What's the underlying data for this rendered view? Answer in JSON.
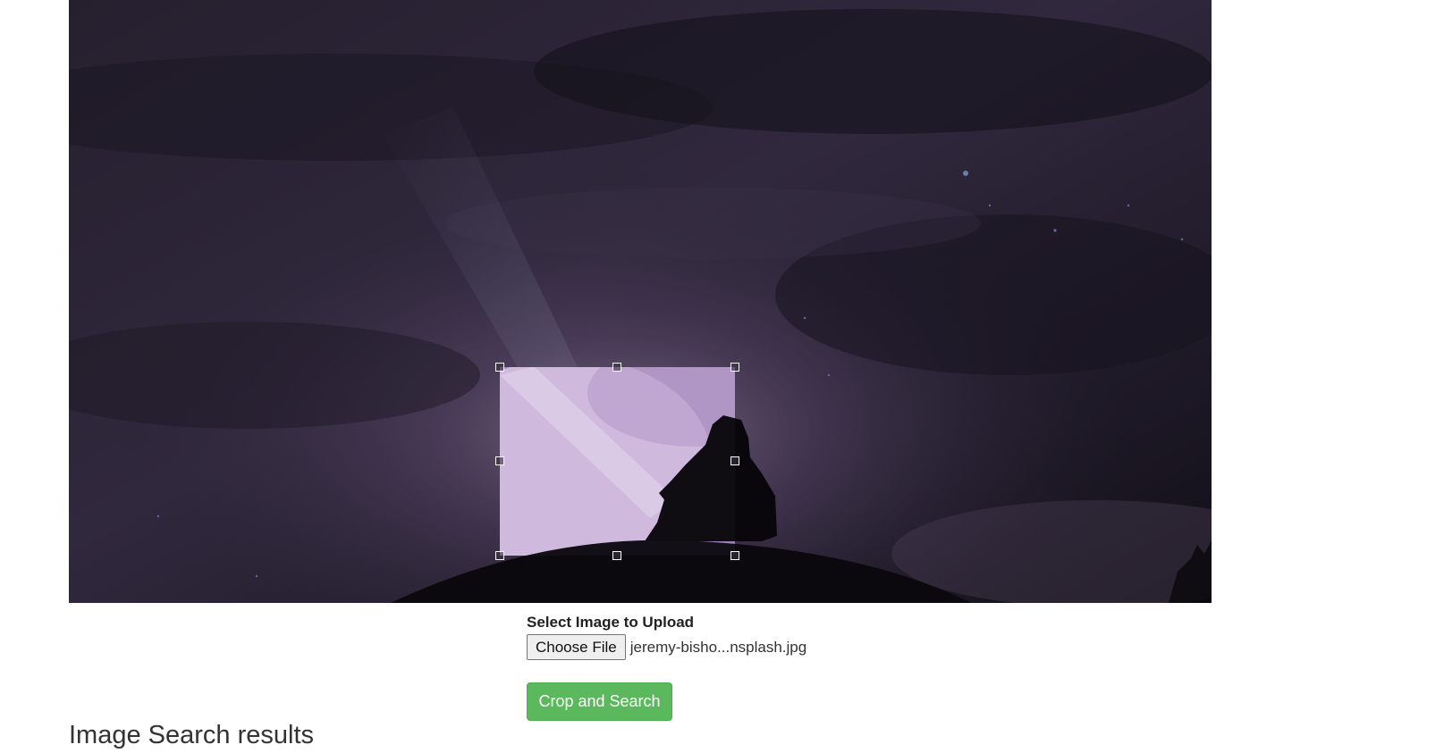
{
  "upload": {
    "label": "Select Image to Upload",
    "choose_file_label": "Choose File",
    "file_name": "jeremy-bisho...nsplash.jpg"
  },
  "actions": {
    "crop_and_search_label": "Crop and Search"
  },
  "results": {
    "title": "Image Search results"
  },
  "colors": {
    "crop_button": "#5cb85c",
    "sky_dark": "#1c1826",
    "sky_mid": "#4a3d5c",
    "sky_light": "#c9b0d8"
  }
}
